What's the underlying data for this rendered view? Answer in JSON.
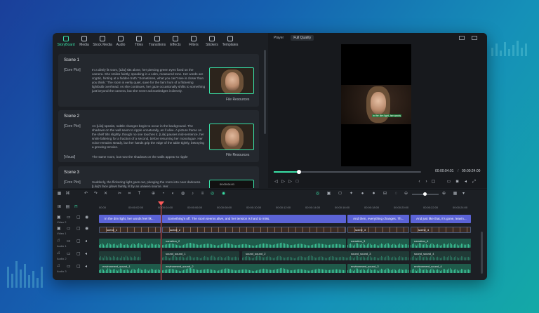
{
  "toolbar": {
    "items": [
      {
        "label": "StoryBoard",
        "active": true
      },
      {
        "label": "Media"
      },
      {
        "label": "Stock Media"
      },
      {
        "label": "Audio"
      },
      {
        "label": "Titles"
      },
      {
        "label": "Transitions"
      },
      {
        "label": "Effects"
      },
      {
        "label": "Filters"
      },
      {
        "label": "Stickers"
      },
      {
        "label": "Templates"
      }
    ]
  },
  "scenes": [
    {
      "title": "Scene 1",
      "core_label": "[Core Plot]",
      "core_text": "In a dimly lit room, [Lila] sits alone, her piercing green eyes fixed on the camera. She smiles faintly, speaking in a calm, measured tone. Her words are cryptic, hinting at a hidden truth: 'Sometimes, what you can't see is closer than you think.' The room is eerily quiet, save for the faint hum of a flickering lightbulb overhead. As she continues, her gaze occasionally shifts to something just beyond the camera, but she never acknowledges it directly.",
      "resource": "File Resources"
    },
    {
      "title": "Scene 2",
      "core_label": "[Core Plot]",
      "core_text": "As [Lila] speaks, subtle changes begin to occur in the background. The shadows on the wall seem to ripple unnaturally, as if alive. A picture frame on the shelf tilts slightly, though no one touches it. [Lila] pauses mid-sentence, her smile faltering for a fraction of a second, before resuming her monologue. Her voice remains steady, but her hands grip the edge of the table tightly, betraying a growing tension.",
      "visual_label": "[Visual]",
      "visual_text": "The same room, but now the shadows on the walls appear to ripple",
      "resource": "File Resources"
    },
    {
      "title": "Scene 3",
      "core_label": "[Core Plot]",
      "core_text": "Suddenly, the flickering light goes out, plunging the room into near darkness. [Lila]'s face glows faintly, lit by an unseen source. Her",
      "thumb_time": "00:00:04:01"
    }
  ],
  "player": {
    "label": "Player",
    "quality": "Full Quality",
    "subtitle": "In the dim light, her words",
    "current_time": "00:00:04:01",
    "total_time": "00:00:24:00",
    "progress": 0.17
  },
  "timeline": {
    "ticks": [
      "00:00",
      "00:00:02:00",
      "00:00:04:00",
      "00:00:06:00",
      "00:00:08:00",
      "00:00:10:00",
      "00:00:12:00",
      "00:00:14:00",
      "00:00:16:00",
      "00:00:18:00",
      "00:00:20:00",
      "00:00:22:00",
      "00:00:24:00"
    ],
    "tracks": {
      "video2": "Video 2",
      "video1": "Video 1",
      "audio1": "Audio 1",
      "audio2": "Audio 2",
      "audio3": "Audio 3"
    },
    "titles": [
      "In the dim light, her words feel lik...",
      "Something's off. The room seems alive, and her tension is hard to miss.",
      "And then, everything changes. Th...",
      "And just like that, it's gone, leavin..."
    ],
    "video_clips": [
      "scene_1",
      "scene_2",
      "scene_3",
      "scene_4"
    ],
    "audio1_clips": [
      "narration_1",
      "narration_2",
      "narration_3",
      "narration_4"
    ],
    "audio2_clips": [
      "sound_sound_1",
      "sound_sound_2",
      "sound_sound_3",
      "sound_sound_4"
    ],
    "audio3_clips": [
      "environment_sound_1",
      "environment_sound_2",
      "environment_sound_3",
      "environment_sound_4"
    ]
  }
}
